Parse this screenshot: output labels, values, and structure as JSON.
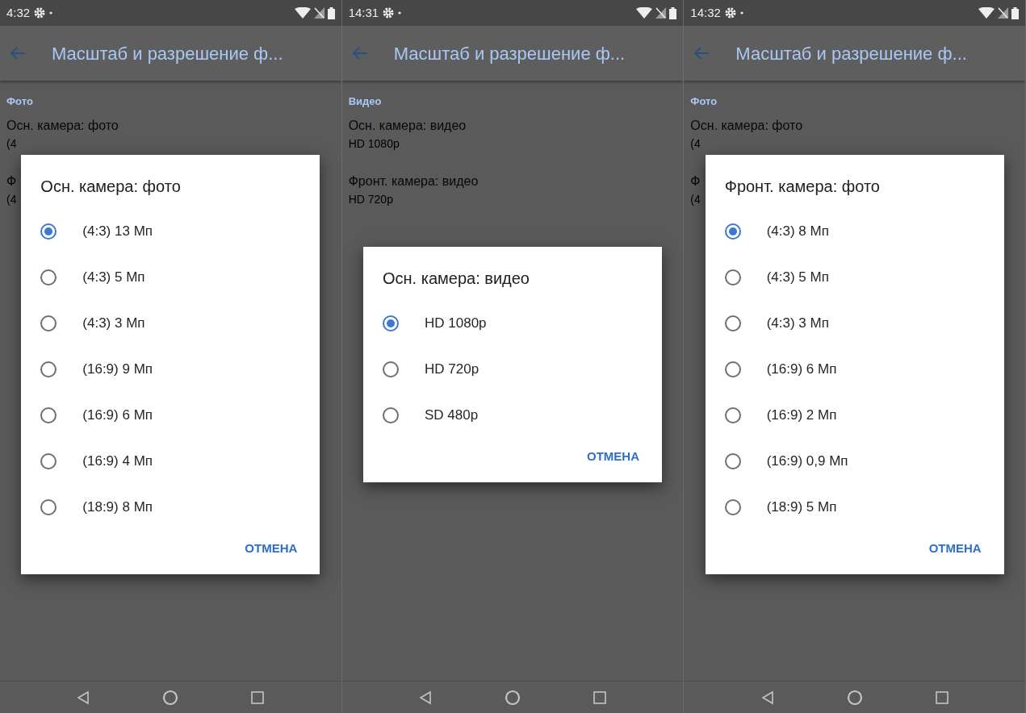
{
  "screens": [
    {
      "status_time": "4:32",
      "title": "Масштаб и разрешение ф...",
      "section": "Фото",
      "items": [
        {
          "title": "Осн. камера: фото",
          "summary": "(4"
        },
        {
          "title": "Ф",
          "summary": "(4"
        }
      ],
      "dialog": {
        "title": "Осн. камера: фото",
        "options": [
          {
            "label": "(4:3) 13 Мп",
            "selected": true
          },
          {
            "label": "(4:3) 5 Мп",
            "selected": false
          },
          {
            "label": "(4:3) 3 Мп",
            "selected": false
          },
          {
            "label": "(16:9) 9 Мп",
            "selected": false
          },
          {
            "label": "(16:9) 6 Мп",
            "selected": false
          },
          {
            "label": "(16:9) 4 Мп",
            "selected": false
          },
          {
            "label": "(18:9) 8 Мп",
            "selected": false
          }
        ],
        "cancel": "ОТМЕНА"
      }
    },
    {
      "status_time": "14:31",
      "title": "Масштаб и разрешение ф...",
      "section": "Видео",
      "items": [
        {
          "title": "Осн. камера: видео",
          "summary": "HD 1080p"
        },
        {
          "title": "Фронт. камера: видео",
          "summary": "HD 720p"
        }
      ],
      "dialog": {
        "title": "Осн. камера: видео",
        "options": [
          {
            "label": "HD 1080p",
            "selected": true
          },
          {
            "label": "HD 720p",
            "selected": false
          },
          {
            "label": "SD 480p",
            "selected": false
          }
        ],
        "cancel": "ОТМЕНА"
      }
    },
    {
      "status_time": "14:32",
      "title": "Масштаб и разрешение ф...",
      "section": "Фото",
      "items": [
        {
          "title": "Осн. камера: фото",
          "summary": "(4"
        },
        {
          "title": "Ф",
          "summary": "(4"
        }
      ],
      "dialog": {
        "title": "Фронт. камера: фото",
        "options": [
          {
            "label": "(4:3) 8 Мп",
            "selected": true
          },
          {
            "label": "(4:3) 5 Мп",
            "selected": false
          },
          {
            "label": "(4:3) 3 Мп",
            "selected": false
          },
          {
            "label": "(16:9) 6 Мп",
            "selected": false
          },
          {
            "label": "(16:9) 2 Мп",
            "selected": false
          },
          {
            "label": "(16:9) 0,9 Мп",
            "selected": false
          },
          {
            "label": "(18:9) 5 Мп",
            "selected": false
          }
        ],
        "cancel": "ОТМЕНА"
      }
    }
  ]
}
